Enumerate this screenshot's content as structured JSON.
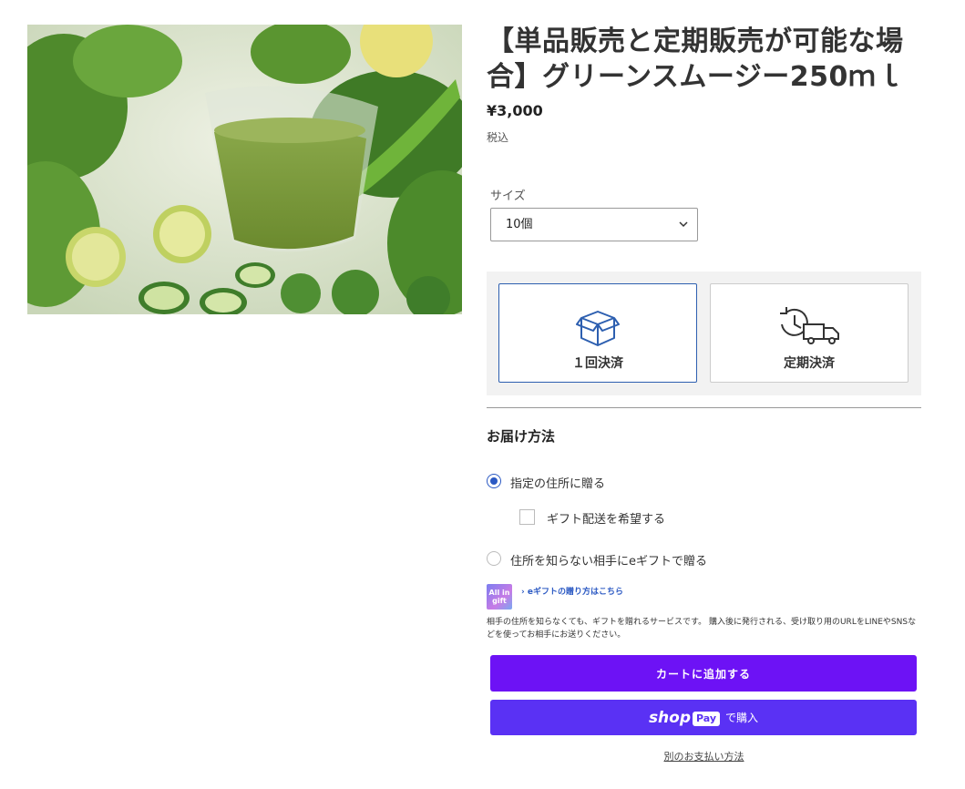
{
  "product": {
    "title": "【単品販売と定期販売が可能な場合】グリーンスムージー250ｍｌ",
    "price": "¥3,000",
    "tax_note": "税込",
    "image_alt": "green-smoothie-photo"
  },
  "size": {
    "label": "サイズ",
    "selected": "10個"
  },
  "plans": [
    {
      "label": "１回決済",
      "icon": "box-icon",
      "selected": true
    },
    {
      "label": "定期決済",
      "icon": "recurring-delivery-truck-icon",
      "selected": false
    }
  ],
  "delivery": {
    "title": "お届け方法",
    "option_address": "指定の住所に贈る",
    "gift_checkbox": "ギフト配送を希望する",
    "option_egift": "住所を知らない相手にeギフトで贈る",
    "gift_logo_text": "All in gift",
    "gift_link": "eギフトの贈り方はこちら",
    "gift_description": "相手の住所を知らなくても、ギフトを贈れるサービスです。 購入後に発行される、受け取り用のURLをLINEやSNSなどを使ってお相手にお送りください。"
  },
  "buttons": {
    "add_to_cart": "カートに追加する",
    "shop_text": "shop",
    "pay_text": "Pay",
    "buy_text": "で購入",
    "other_payment": "別のお支払い方法"
  },
  "colors": {
    "add_to_cart_bg": "#6d12f5",
    "shoppay_bg": "#5a31f4",
    "selected_border": "#2d5fb0"
  }
}
